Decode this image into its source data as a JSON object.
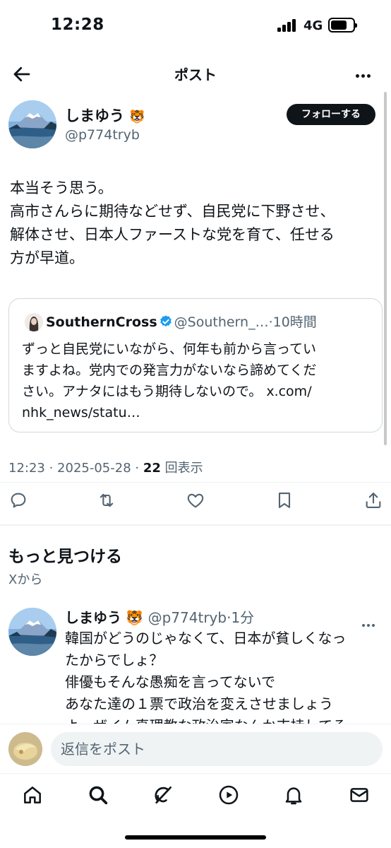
{
  "status_bar": {
    "time": "12:28",
    "network": "4G"
  },
  "header": {
    "title": "ポスト"
  },
  "post": {
    "author_name": "しまゆう",
    "author_emoji": "🐯",
    "author_handle": "@p774tryb",
    "follow_label": "フォローする",
    "text": "本当そう思う。\n高市さんらに期待などせず、自民党に下野させ、\n解体させ、日本人ファーストな党を育て、任せる\n方が早道。",
    "quote": {
      "name": "SouthernCross",
      "handle": "@Southern_…",
      "time": "·10時間",
      "text": "ずっと自民党にいながら、何年も前から言ってい\nますよね。党内での発言力がないなら諦めてくだ\nさい。アナタにはもう期待しないので。 x.com/\nnhk_news/statu…"
    },
    "meta_time": "12:23 · 2025-05-28 · ",
    "views_count": "22",
    "views_label": " 回表示"
  },
  "actions": [
    "reply-icon",
    "repost-icon",
    "like-icon",
    "bookmark-icon",
    "share-icon"
  ],
  "discover": {
    "title": "もっと見つける",
    "subtitle": "Xから"
  },
  "recommended": {
    "author_name": "しまゆう",
    "author_emoji": "🐯",
    "author_handle": "@p774tryb",
    "time": "·1分",
    "text": "韓国がどうのじゃなくて、日本が貧しくなっ\nたからでしょ？\n俳優もそんな愚痴を言ってないで\nあなた達の１票で政治を変えさせましょう\nよ。ザイム真理教な政治家なんか支持してる"
  },
  "reply_bar": {
    "placeholder": "返信をポスト"
  },
  "tab_bar": [
    "home-icon",
    "search-icon",
    "grok-icon",
    "video-icon",
    "notifications-icon",
    "messages-icon"
  ],
  "colors": {
    "text": "#0f1419",
    "muted": "#536471",
    "verified": "#1d9bf0",
    "border": "#cfd9de"
  }
}
